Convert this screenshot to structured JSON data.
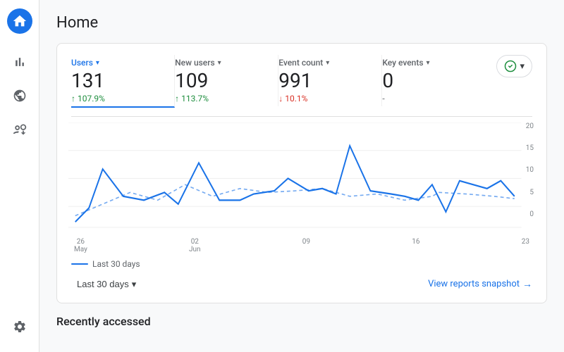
{
  "page": {
    "title": "Home",
    "recently_accessed_label": "Recently accessed"
  },
  "sidebar": {
    "logo_alt": "Analytics logo",
    "items": [
      {
        "name": "bar-chart",
        "label": "Reports"
      },
      {
        "name": "face",
        "label": "Explore"
      },
      {
        "name": "antenna",
        "label": "Advertising"
      }
    ],
    "bottom": {
      "name": "settings",
      "label": "Settings"
    }
  },
  "metrics": [
    {
      "label": "Users",
      "active": true,
      "value": "131",
      "change": "↑ 107.9%",
      "change_type": "up"
    },
    {
      "label": "New users",
      "active": false,
      "value": "109",
      "change": "↑ 113.7%",
      "change_type": "up"
    },
    {
      "label": "Event count",
      "active": false,
      "value": "991",
      "change": "↓ 10.1%",
      "change_type": "down"
    },
    {
      "label": "Key events",
      "active": false,
      "value": "0",
      "change": "-",
      "change_type": "neutral"
    }
  ],
  "chart": {
    "y_labels": [
      "20",
      "15",
      "10",
      "5",
      "0"
    ],
    "x_labels": [
      {
        "date": "26",
        "month": "May"
      },
      {
        "date": "02",
        "month": "Jun"
      },
      {
        "date": "09",
        "month": ""
      },
      {
        "date": "16",
        "month": ""
      },
      {
        "date": "23",
        "month": ""
      }
    ],
    "legend": "Last 30 days"
  },
  "footer": {
    "date_range_label": "Last 30 days",
    "view_reports_label": "View reports snapshot",
    "chevron_icon": "▾",
    "arrow_icon": "→"
  }
}
